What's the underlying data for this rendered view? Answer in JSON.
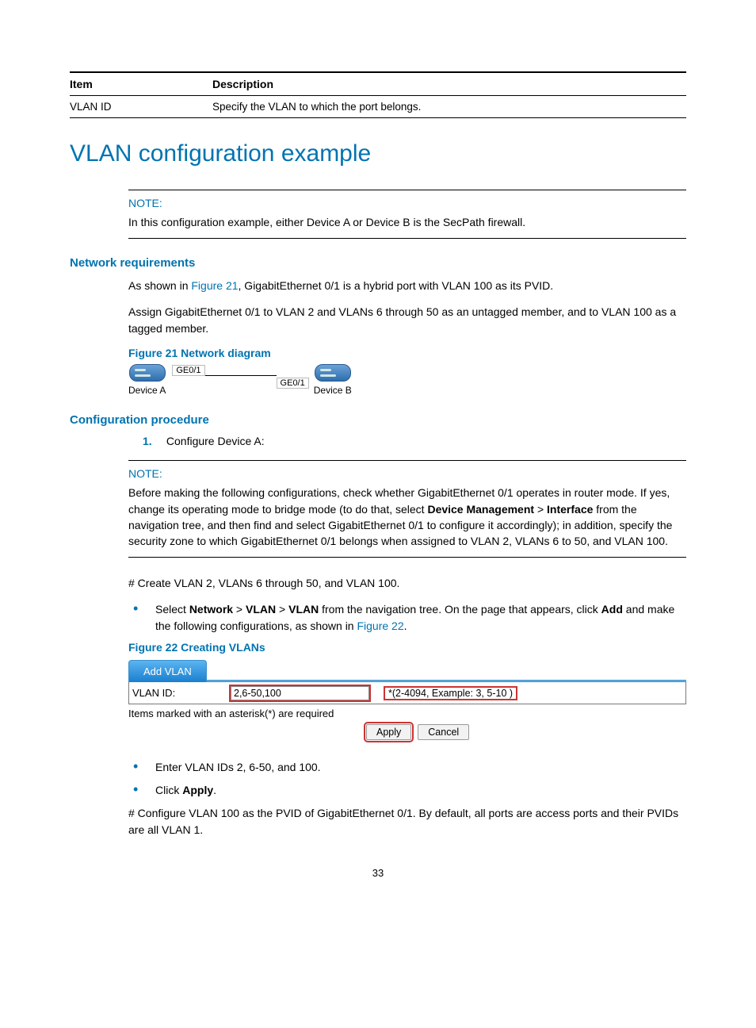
{
  "table": {
    "headers": [
      "Item",
      "Description"
    ],
    "row": {
      "item": "VLAN ID",
      "desc": "Specify the VLAN to which the port belongs."
    }
  },
  "h1": "VLAN configuration example",
  "note1": {
    "label": "NOTE:",
    "text": "In this configuration example, either Device A or Device B is the SecPath firewall."
  },
  "req": {
    "heading": "Network requirements",
    "p1_a": "As shown in ",
    "p1_link": "Figure 21",
    "p1_b": ", GigabitEthernet 0/1 is a hybrid port with VLAN 100 as its PVID.",
    "p2": "Assign GigabitEthernet 0/1 to VLAN 2 and VLANs 6 through 50 as an untagged member, and to VLAN 100 as a tagged member."
  },
  "fig21": {
    "label": "Figure 21 Network diagram",
    "ge_top": "GE0/1",
    "ge_bot": "GE0/1",
    "devA": "Device A",
    "devB": "Device B"
  },
  "proc": {
    "heading": "Configuration procedure",
    "step1_num": "1.",
    "step1": "Configure Device A:"
  },
  "note2": {
    "label": "NOTE:",
    "text_a": "Before making the following configurations, check whether GigabitEthernet 0/1 operates in router mode. If yes, change its operating mode to bridge mode (to do that, select ",
    "b1": "Device Management",
    "gt1": " > ",
    "b2": "Interface",
    "text_b": " from the navigation tree, and then find and select GigabitEthernet 0/1 to configure it accordingly); in addition, specify the security zone to which GigabitEthernet 0/1 belongs when assigned to VLAN 2, VLANs 6 to 50, and VLAN 100."
  },
  "create": "# Create VLAN 2, VLANs 6 through 50, and VLAN 100.",
  "bul1": {
    "a": "Select ",
    "b1": "Network",
    "gt": " > ",
    "b2": "VLAN",
    "b3": "VLAN",
    "mid": " from the navigation tree. On the page that appears, click ",
    "b4": "Add",
    "end": " and make the following configurations, as shown in ",
    "link": "Figure 22",
    "dot": "."
  },
  "fig22": {
    "label": "Figure 22 Creating VLANs",
    "tab": "Add VLAN",
    "field_label": "VLAN ID:",
    "field_value": "2,6-50,100",
    "hint": "*(2-4094, Example: 3, 5-10 )",
    "asterisk": "Items marked with an asterisk(*) are required",
    "apply": "Apply",
    "cancel": "Cancel"
  },
  "bul2": "Enter VLAN IDs 2, 6-50, and 100.",
  "bul3_a": "Click ",
  "bul3_b": "Apply",
  "bul3_c": ".",
  "pvid": "# Configure VLAN 100 as the PVID of GigabitEthernet 0/1. By default, all ports are access ports and their PVIDs are all VLAN 1.",
  "page_num": "33"
}
